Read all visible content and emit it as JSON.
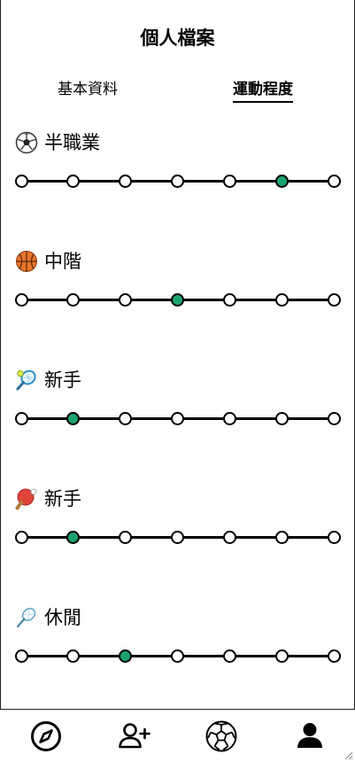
{
  "header": {
    "title": "個人檔案"
  },
  "tabs": [
    {
      "label": "基本資料",
      "active": false
    },
    {
      "label": "運動程度",
      "active": true
    }
  ],
  "sports": [
    {
      "icon": "soccer-ball-icon",
      "level_label": "半職業",
      "scale_steps": 7,
      "selected_index": 5
    },
    {
      "icon": "basketball-icon",
      "level_label": "中階",
      "scale_steps": 7,
      "selected_index": 3
    },
    {
      "icon": "tennis-racket-icon",
      "level_label": "新手",
      "scale_steps": 7,
      "selected_index": 1
    },
    {
      "icon": "ping-pong-paddle-icon",
      "level_label": "新手",
      "scale_steps": 7,
      "selected_index": 1
    },
    {
      "icon": "badminton-racket-icon",
      "level_label": "休閒",
      "scale_steps": 7,
      "selected_index": 2
    }
  ],
  "bottom_nav": [
    {
      "icon": "compass-icon"
    },
    {
      "icon": "add-friend-icon"
    },
    {
      "icon": "soccer-ball-icon"
    },
    {
      "icon": "profile-icon"
    }
  ],
  "colors": {
    "selected_dot": "#1aa36e",
    "line": "#000000"
  }
}
